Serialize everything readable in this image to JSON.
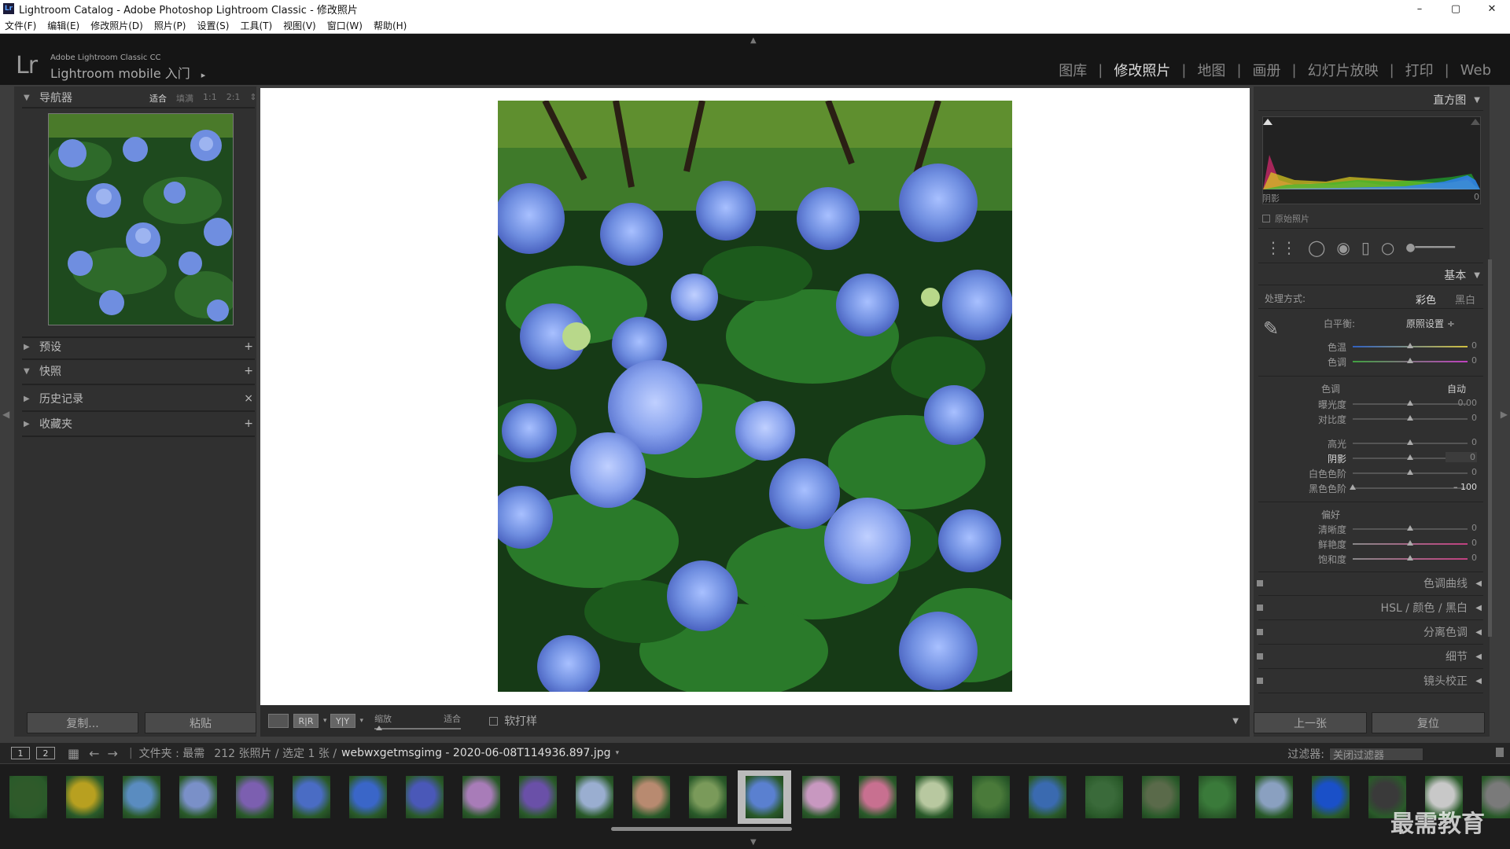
{
  "window": {
    "title": "Lightroom Catalog - Adobe Photoshop Lightroom Classic - 修改照片",
    "controls": [
      "–",
      "▢",
      "✕"
    ]
  },
  "menu": [
    "文件(F)",
    "编辑(E)",
    "修改照片(D)",
    "照片(P)",
    "设置(S)",
    "工具(T)",
    "视图(V)",
    "窗口(W)",
    "帮助(H)"
  ],
  "identity": {
    "logo": "Lr",
    "product": "Adobe Lightroom Classic CC",
    "mobile": "Lightroom mobile 入门",
    "arrow": "▸"
  },
  "modules": [
    "图库",
    "修改照片",
    "地图",
    "画册",
    "幻灯片放映",
    "打印",
    "Web"
  ],
  "active_module": "修改照片",
  "left_panel": {
    "navigator": {
      "title": "导航器",
      "zoom": [
        "适合",
        "填满",
        "1:1",
        "2:1"
      ],
      "zoom_more": "⇕"
    },
    "sections": [
      {
        "title": "预设",
        "action": "+"
      },
      {
        "title": "快照",
        "action": "+"
      },
      {
        "title": "历史记录",
        "action": "×"
      },
      {
        "title": "收藏夹",
        "action": "+"
      }
    ],
    "copy_label": "复制...",
    "paste_label": "粘贴"
  },
  "toolbar": {
    "view_modes": [
      "",
      "R|R",
      "Y|Y"
    ],
    "zoom_label": "缩放",
    "zoom_value": "适合",
    "softproof_label": "软打样",
    "expand": "▼"
  },
  "right_panel": {
    "histogram": {
      "title": "直方图",
      "left_label": "阴影",
      "right_label": "0",
      "original_label": "原始照片"
    },
    "basic": {
      "title": "基本",
      "treatment_label": "处理方式:",
      "treatment_color": "彩色",
      "treatment_bw": "黑白",
      "wb_label": "白平衡:",
      "wb_value": "原照设置 ÷",
      "temp": {
        "label": "色温",
        "value": "0",
        "pos": 0.5
      },
      "tint": {
        "label": "色调",
        "value": "0",
        "pos": 0.5
      },
      "tone_label": "色调",
      "auto_label": "自动",
      "exposure": {
        "label": "曝光度",
        "value": "0.00",
        "pos": 0.5
      },
      "contrast": {
        "label": "对比度",
        "value": "0",
        "pos": 0.5
      },
      "highlights": {
        "label": "高光",
        "value": "0",
        "pos": 0.5
      },
      "shadows": {
        "label": "阴影",
        "value": "0",
        "pos": 0.5
      },
      "whites": {
        "label": "白色色阶",
        "value": "0",
        "pos": 0.5
      },
      "blacks": {
        "label": "黑色色阶",
        "value": "– 100",
        "pos": 0.0
      },
      "presence_label": "偏好",
      "clarity": {
        "label": "清晰度",
        "value": "0",
        "pos": 0.5
      },
      "vibrance": {
        "label": "鲜艳度",
        "value": "0",
        "pos": 0.5
      },
      "saturation": {
        "label": "饱和度",
        "value": "0",
        "pos": 0.5
      }
    },
    "collapsed_panels": [
      "色调曲线",
      "HSL / 颜色 / 黑白",
      "分离色调",
      "细节",
      "镜头校正"
    ],
    "prev_label": "上一张",
    "reset_label": "复位"
  },
  "filmstrip": {
    "pages": [
      "1",
      "2"
    ],
    "folder": "文件夹 : 最需",
    "count": "212 张照片 / 选定 1 张 /",
    "filename": "webwxgetmsgimg - 2020-06-08T114936.897.jpg",
    "filter_label": "过滤器:",
    "filter_value": "关闭过滤器",
    "selected_index": 13,
    "thumb_colors": [
      "#2f5a2a",
      "#b8a020",
      "#5a8cc0",
      "#7a90c8",
      "#7c5fb0",
      "#4a6cc4",
      "#3a66c8",
      "#4a58b8",
      "#a87cb8",
      "#6a50a8",
      "#9aaed0",
      "#b88a70",
      "#7a9a5a",
      "#5a80d0",
      "#c898c0",
      "#c87090",
      "#b8c8a0",
      "#4a7a3a",
      "#3a6ab0",
      "#3a6a3a",
      "#5a6a4a",
      "#3a7a3a",
      "#8aa0c0",
      "#1a50c8",
      "#3a3a3a",
      "#c8c8c8",
      "#7a7a7a"
    ],
    "watermark": "最需教育"
  }
}
